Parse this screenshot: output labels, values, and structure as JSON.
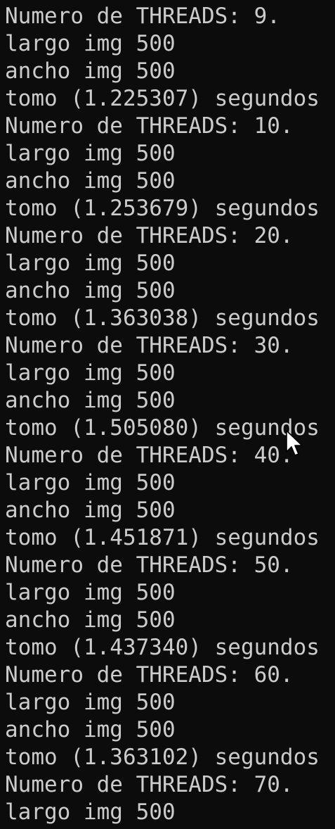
{
  "terminal": {
    "lines": [
      "Numero de THREADS: 9.",
      "largo img 500",
      "ancho img 500",
      "tomo (1.225307) segundos",
      "Numero de THREADS: 10.",
      "largo img 500",
      "ancho img 500",
      "tomo (1.253679) segundos",
      "Numero de THREADS: 20.",
      "largo img 500",
      "ancho img 500",
      "tomo (1.363038) segundos",
      "Numero de THREADS: 30.",
      "largo img 500",
      "ancho img 500",
      "tomo (1.505080) segundos",
      "Numero de THREADS: 40.",
      "largo img 500",
      "ancho img 500",
      "tomo (1.451871) segundos",
      "Numero de THREADS: 50.",
      "largo img 500",
      "ancho img 500",
      "tomo (1.437340) segundos",
      "Numero de THREADS: 60.",
      "largo img 500",
      "ancho img 500",
      "tomo (1.363102) segundos",
      "Numero de THREADS: 70.",
      "largo img 500"
    ],
    "background_color": "#0c0c0c",
    "text_color": "#cccccc"
  },
  "cursor": {
    "icon": "arrow-pointer-icon"
  }
}
